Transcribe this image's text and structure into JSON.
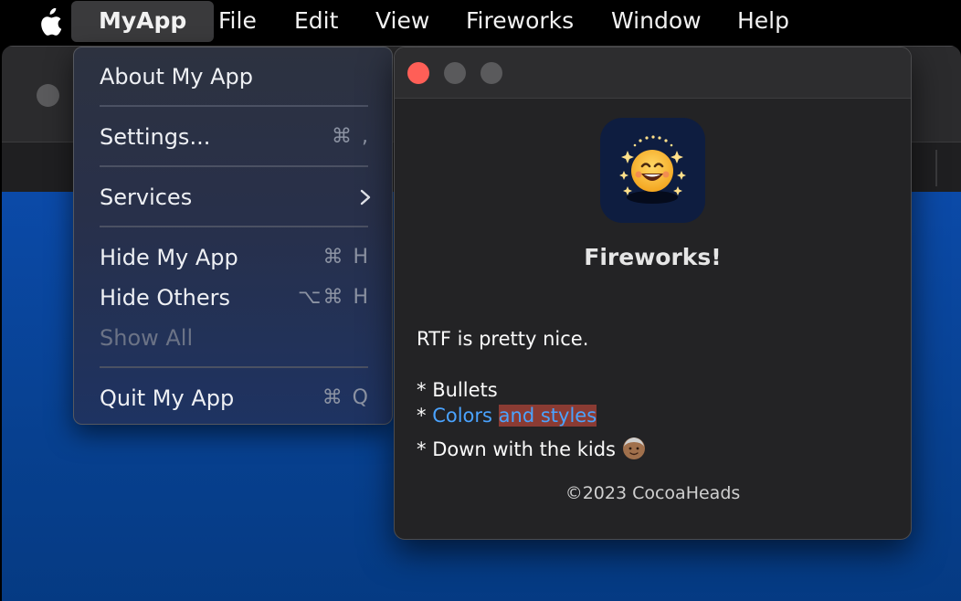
{
  "menubar": {
    "apple_icon": "apple-logo",
    "app_name": "MyApp",
    "items": [
      "File",
      "Edit",
      "View",
      "Fireworks",
      "Window",
      "Help"
    ]
  },
  "app_menu": {
    "about": "About My App",
    "settings": {
      "label": "Settings...",
      "shortcut": "⌘ ,"
    },
    "services": {
      "label": "Services",
      "icon": "chevron-right-icon"
    },
    "hide": {
      "label": "Hide My App",
      "shortcut": "⌘ H"
    },
    "hide_others": {
      "label": "Hide Others",
      "shortcut": "⌥⌘ H"
    },
    "show_all": "Show All",
    "quit": {
      "label": "Quit My App",
      "shortcut": "⌘ Q"
    }
  },
  "about_window": {
    "icon": "fireworks-smiley-app-icon",
    "title": "Fireworks!",
    "line1": "RTF is pretty nice.",
    "bullet_prefix": "* ",
    "bullet1": "Bullets",
    "bullet2_link": "Colors",
    "bullet2_highlight": "and styles",
    "bullet3": "Down with the kids",
    "bullet3_emoji": "older-man-emoji",
    "copyright": "©2023 CocoaHeads"
  },
  "colors": {
    "close_button": "#ff5f57",
    "link": "#4aa3ff",
    "highlight": "#8a3b33",
    "desktop_blue": "#0b4aa8"
  }
}
